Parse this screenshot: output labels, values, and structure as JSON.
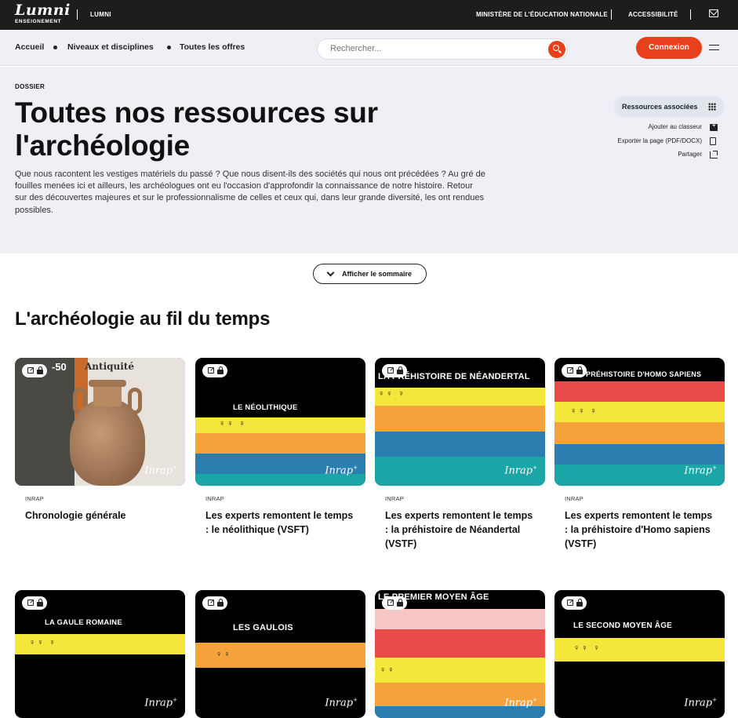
{
  "topbar": {
    "logo": "Lumni",
    "logo_sub": "ENSEIGNEMENT",
    "lumni_link": "LUMNI",
    "ministry": "MINISTÈRE DE L'ÉDUCATION NATIONALE",
    "accessibility": "ACCESSIBILITÉ",
    "mail_icon": "mail-icon"
  },
  "nav": {
    "home": "Accueil",
    "levels": "Niveaux et disciplines",
    "offers": "Toutes les offres",
    "search_placeholder": "Rechercher...",
    "login": "Connexion",
    "accent_color": "#e8401c"
  },
  "hero": {
    "kicker": "DOSSIER",
    "title": "Toutes nos ressources sur l'archéologie",
    "description": "Que nous racontent les vestiges matériels du passé ? Que nous disent-ils des sociétés qui nous ont précédées ? Au gré de fouilles menées ici et ailleurs, les archéologues ont eu l'occasion d'approfondir la connaissance de notre histoire. Retour sur des découvertes majeures et sur le professionnalisme de celles et ceux qui, dans leur grande diversité, les ont rendues possibles.",
    "related_button": "Ressources associées",
    "actions": {
      "add": "Ajouter au classeur",
      "export": "Exporter la page (PDF/DOCX)",
      "share": "Partager"
    }
  },
  "summary_button": "Afficher le sommaire",
  "section_title": "L'archéologie au fil du temps",
  "cards": [
    {
      "source": "INRAP",
      "title": "Chronologie générale",
      "thumb_label_1": "-50",
      "thumb_label_2": "Antiquité"
    },
    {
      "source": "INRAP",
      "title": "Les experts remontent le temps : le néolithique (VSFT)",
      "thumb_label": "LE NÉOLITHIQUE"
    },
    {
      "source": "INRAP",
      "title": "Les experts remontent le temps : la préhistoire de Néandertal (VSTF)",
      "thumb_label": "LA PRÉHISTOIRE DE NÉANDERTAL"
    },
    {
      "source": "INRAP",
      "title": "Les experts remontent le temps : la préhistoire d'Homo sapiens (VSTF)",
      "thumb_label": "PRÉHISTOIRE D'HOMO SAPIENS"
    },
    {
      "thumb_label": "LA GAULE ROMAINE"
    },
    {
      "thumb_label": "LES GAULOIS"
    },
    {
      "thumb_label": "LE PREMIER MOYEN ÂGE"
    },
    {
      "thumb_label": "LE SECOND MOYEN ÂGE"
    }
  ],
  "brand": "Inrap"
}
